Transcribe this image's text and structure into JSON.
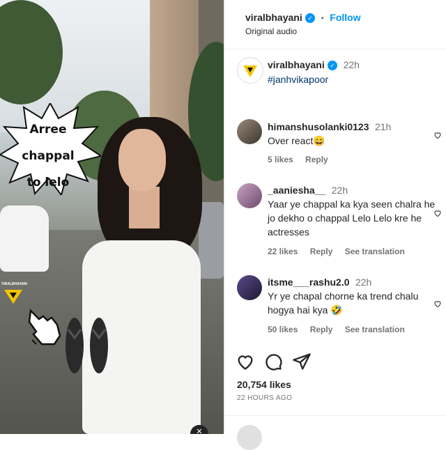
{
  "post": {
    "username": "viralbhayani",
    "follow_label": "Follow",
    "audio": "Original audio",
    "caption_username": "viralbhayani",
    "caption_time": "22h",
    "caption_text": "#janhvikapoor"
  },
  "media": {
    "overlay_text": [
      "Arree",
      "chappal",
      "to lelo"
    ],
    "watermark": "VIRALBHAYANI"
  },
  "comments": [
    {
      "username": "himanshusolanki0123",
      "time": "21h",
      "text": "Over react😄",
      "likes": "5 likes",
      "reply": "Reply",
      "translate": ""
    },
    {
      "username": "_aaniesha__",
      "time": "22h",
      "text": "Yaar ye chappal ka kya seen chalra he jo dekho o chappal Lelo Lelo kre he actresses",
      "likes": "22 likes",
      "reply": "Reply",
      "translate": "See translation"
    },
    {
      "username": "itsme___rashu2.0",
      "time": "22h",
      "text": "Yr ye chapal chorne ka trend chalu hogya hai kya 🤣",
      "likes": "50 likes",
      "reply": "Reply",
      "translate": "See translation"
    }
  ],
  "stats": {
    "likes": "20,754 likes",
    "time_ago": "22 HOURS AGO"
  },
  "icons": [
    "heart-icon",
    "comment-icon",
    "share-icon",
    "verified-badge-icon",
    "close-icon"
  ],
  "colors": {
    "accent": "#0095f6",
    "text": "#262626",
    "muted": "#737373"
  }
}
